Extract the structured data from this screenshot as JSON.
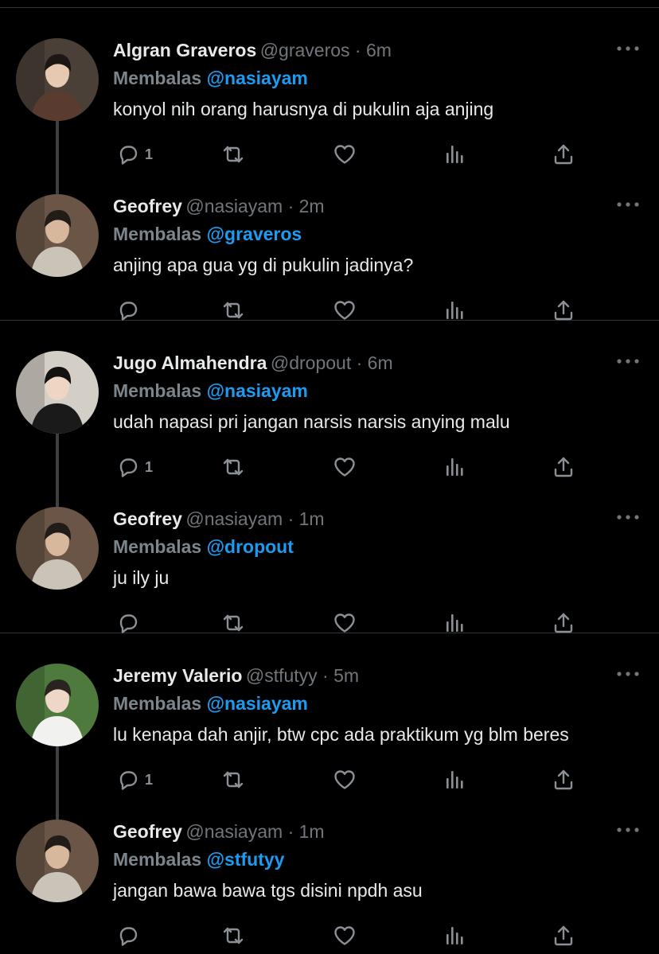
{
  "reply_prefix": "Membalas",
  "threads": [
    {
      "tweets": [
        {
          "name": "Algran Graveros",
          "handle": "@graveros",
          "time": "6m",
          "reply_to": "@nasiayam",
          "text": "konyol nih orang harusnya di pukulin aja anjing",
          "reply_count": "1"
        },
        {
          "name": "Geofrey",
          "handle": "@nasiayam",
          "time": "2m",
          "reply_to": "@graveros",
          "text": "anjing apa gua yg di pukulin jadinya?",
          "reply_count": ""
        }
      ]
    },
    {
      "tweets": [
        {
          "name": "Jugo Almahendra",
          "handle": "@dropout",
          "time": "6m",
          "reply_to": "@nasiayam",
          "text": "udah napasi pri jangan narsis narsis anying malu",
          "reply_count": "1"
        },
        {
          "name": "Geofrey",
          "handle": "@nasiayam",
          "time": "1m",
          "reply_to": "@dropout",
          "text": "ju ily ju",
          "reply_count": ""
        }
      ]
    },
    {
      "tweets": [
        {
          "name": "Jeremy Valerio",
          "handle": "@stfutyy",
          "time": "5m",
          "reply_to": "@nasiayam",
          "text": "lu kenapa dah anjir, btw cpc ada praktikum yg blm beres",
          "reply_count": "1"
        },
        {
          "name": "Geofrey",
          "handle": "@nasiayam",
          "time": "1m",
          "reply_to": "@stfutyy",
          "text": "jangan bawa bawa tgs disini npdh asu",
          "reply_count": ""
        }
      ]
    }
  ],
  "colors": {
    "background": "#000000",
    "mention": "#1d9bf0",
    "muted": "#71767b",
    "divider": "#2f3336",
    "thread_line": "#3e4144"
  },
  "icons": [
    "more-icon",
    "reply-icon",
    "retweet-icon",
    "like-icon",
    "views-icon",
    "share-icon"
  ]
}
